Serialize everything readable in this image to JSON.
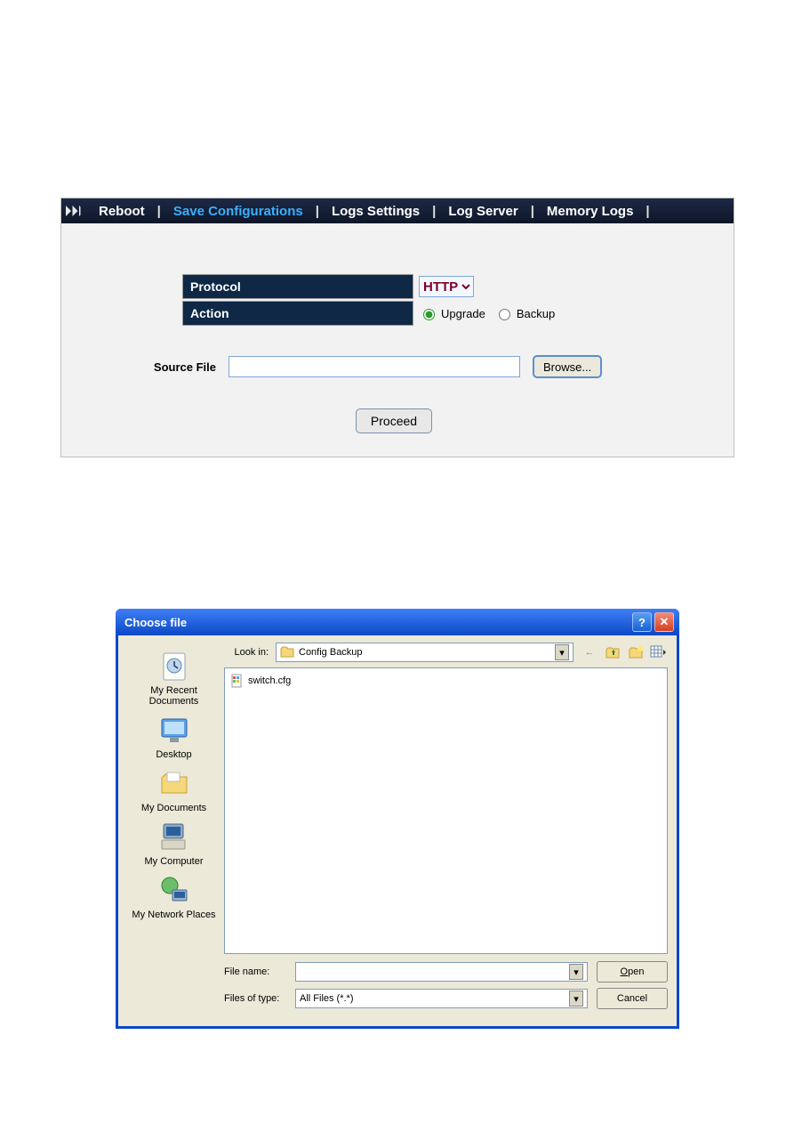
{
  "nav": {
    "reboot": "Reboot",
    "save": "Save Configurations",
    "logs_settings": "Logs Settings",
    "log_server": "Log Server",
    "memory_logs": "Memory Logs"
  },
  "form": {
    "protocol_label": "Protocol",
    "protocol_value": "HTTP",
    "action_label": "Action",
    "action_upgrade": "Upgrade",
    "action_backup": "Backup",
    "source_file_label": "Source File",
    "source_file_value": "",
    "browse_label": "Browse...",
    "proceed_label": "Proceed"
  },
  "dialog": {
    "title": "Choose file",
    "lookin_label": "Look in:",
    "lookin_value": "Config Backup",
    "file_item": "switch.cfg",
    "filename_label": "File name:",
    "filename_value": "",
    "filetype_label": "Files of type:",
    "filetype_value": "All Files (*.*)",
    "open_label": "Open",
    "cancel_label": "Cancel",
    "places": {
      "recent": "My Recent Documents",
      "desktop": "Desktop",
      "mydocs": "My Documents",
      "mycomp": "My Computer",
      "network": "My Network Places"
    }
  }
}
